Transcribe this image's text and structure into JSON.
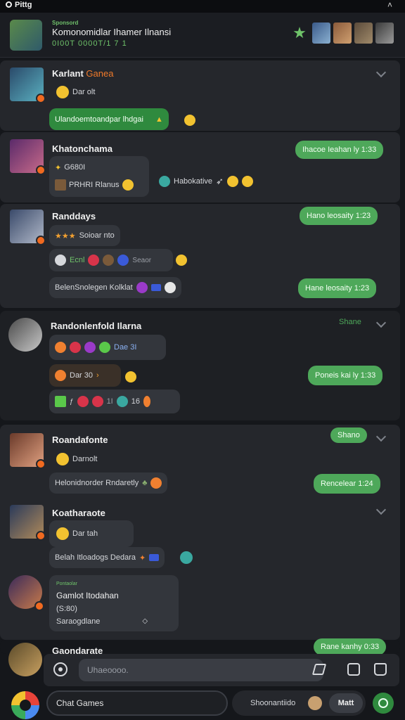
{
  "status": {
    "label": "Pittg",
    "caret": "˄"
  },
  "header": {
    "small": "Sponsord",
    "title": "Komonomidlar Ihamer Ilnansi",
    "sub": "0I00T 0000T/1 7 1",
    "star_icon": "star-icon",
    "colors": {
      "accent": "#4ea85a",
      "brand_orange": "#f07a2a"
    }
  },
  "messages": [
    {
      "user": "Karlant",
      "tag": "Ganea",
      "rows": [
        {
          "text": "Dar olt"
        },
        {
          "text": "Ulandoemtoandpar lhdgai"
        }
      ]
    },
    {
      "user": "Khatonchama",
      "rows": [
        {
          "text": "Ihacoe Ieahan ly 1:33"
        },
        {
          "text": "G680I"
        },
        {
          "text": "PRHRI Rlanus"
        },
        {
          "text": "Habokative"
        }
      ]
    },
    {
      "user": "Randdays",
      "rows": [
        {
          "text": "Hano leosaity 1:23"
        },
        {
          "text": "Soioar nto"
        },
        {
          "text": "Ecnl"
        },
        {
          "text": "Seaor"
        },
        {
          "text": "BelenSnolegen Kolklat"
        },
        {
          "text": "Hane leosaity 1:23"
        }
      ]
    },
    {
      "user": "Randonlenfold Ilarna",
      "share": "Shane",
      "rows": [
        {
          "text": "Dae 3I"
        },
        {
          "text": "Dar 30"
        },
        {
          "text": "Poneis kai ly 1:33"
        },
        {
          "text": "16"
        }
      ]
    },
    {
      "user": "Roandafonte",
      "share": "Shano",
      "rows": [
        {
          "text": "Darnolt"
        },
        {
          "text": "Helonidnorder Rndaretly"
        },
        {
          "text": "Rencelear 1:24"
        }
      ]
    },
    {
      "user": "Koatharaote",
      "rows": [
        {
          "text": "Dar tah"
        },
        {
          "text": "Belah Itloadogs Dedara"
        }
      ]
    },
    {
      "user": "",
      "rows": [
        {
          "text": "Pontaolar"
        },
        {
          "text": "Gamlot Itodahan"
        },
        {
          "text": "(S:80)"
        },
        {
          "text": "Saraogdlane"
        }
      ]
    },
    {
      "user": "Gaondarate",
      "rows": [
        {
          "text": "Rane kanhy 0:33"
        }
      ]
    }
  ],
  "composer": {
    "placeholder": "Uhaeoooo."
  },
  "bottom": {
    "chat_games": "Chat Games",
    "name_label": "Shoonantiido",
    "btn": "Matt"
  }
}
